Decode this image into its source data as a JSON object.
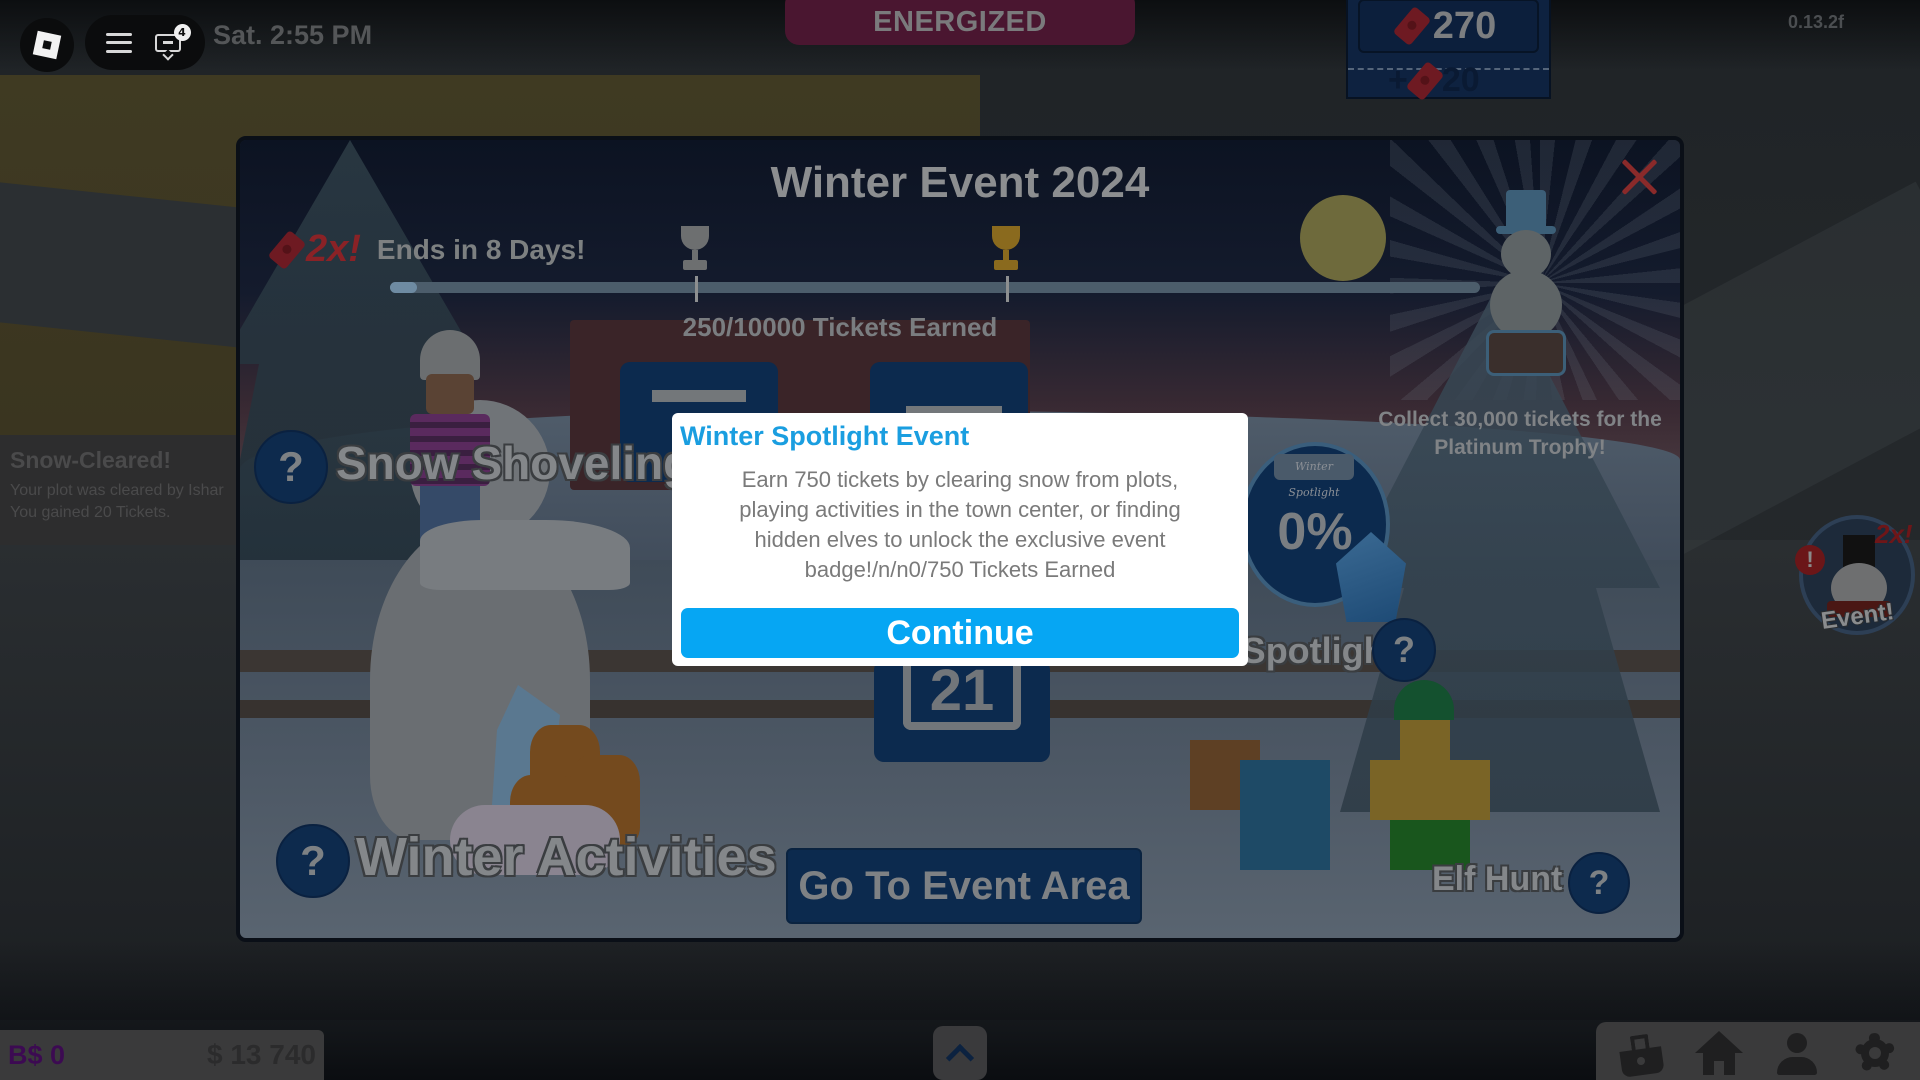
{
  "topbar": {
    "roblox_menu_icon": "roblox-logo-icon",
    "menu_icon": "hamburger-icon",
    "chat_icon": "chat-icon",
    "chat_badge_count": "4",
    "clock": "Sat. 2:55 PM"
  },
  "status_banner": {
    "label": "ENERGIZED"
  },
  "ticket_counter": {
    "total": "270",
    "recent_gain": "+20",
    "gain_value": "20",
    "plus": "+"
  },
  "version": "0.13.2f",
  "notification": {
    "title": "Snow-Cleared!",
    "line1": "Your plot was cleared by Ishar",
    "line2": "You gained 20 Tickets."
  },
  "event_panel": {
    "title": "Winter Event 2024",
    "multiplier": "2x!",
    "ends_in": "Ends in 8 Days!",
    "progress": {
      "earned": 250,
      "goal": 10000,
      "fraction": 0.025,
      "label": "250/10000 Tickets Earned",
      "milestones": [
        {
          "name": "silver-trophy",
          "position_fraction": 0.28
        },
        {
          "name": "gold-trophy",
          "position_fraction": 0.565
        }
      ]
    },
    "platinum_text_line1": "Collect 30,000 tickets for the",
    "platinum_text_line2": "Platinum Trophy!",
    "activities": {
      "snow_shoveling": "Snow Shoveling",
      "winter_activities": "Winter Activities",
      "winter_spotlight": "Winter Spotlight",
      "elf_hunt": "Elf Hunt"
    },
    "help_glyph": "?",
    "spotlight_badge_tag": "Winter Spotlight",
    "spotlight_percent": "0%",
    "calendar_day": "21",
    "go_button": "Go To Event Area"
  },
  "dialog": {
    "title": "Winter Spotlight Event",
    "body": "Earn 750 tickets by clearing snow from plots, playing activities in the town center, or finding hidden elves to unlock the exclusive event badge!/n/n0/750 Tickets Earned",
    "continue_label": "Continue"
  },
  "event_button": {
    "alert": "!",
    "multiplier": "2x!",
    "label": "Event!"
  },
  "currency": {
    "bucks": "B$ 0",
    "cash": "$ 13 740"
  },
  "bottom_nav": {
    "expand_icon": "chevron-up-icon",
    "items": [
      "shop-basket-icon",
      "home-icon",
      "profile-icon",
      "settings-gear-icon"
    ]
  },
  "colors": {
    "dialog_title": "#1a9ee0",
    "continue_button": "#06a6f3",
    "panel_button": "#0c2a4e",
    "multiplier_red": "#8a2226",
    "bucks_purple": "#3c0a52"
  }
}
